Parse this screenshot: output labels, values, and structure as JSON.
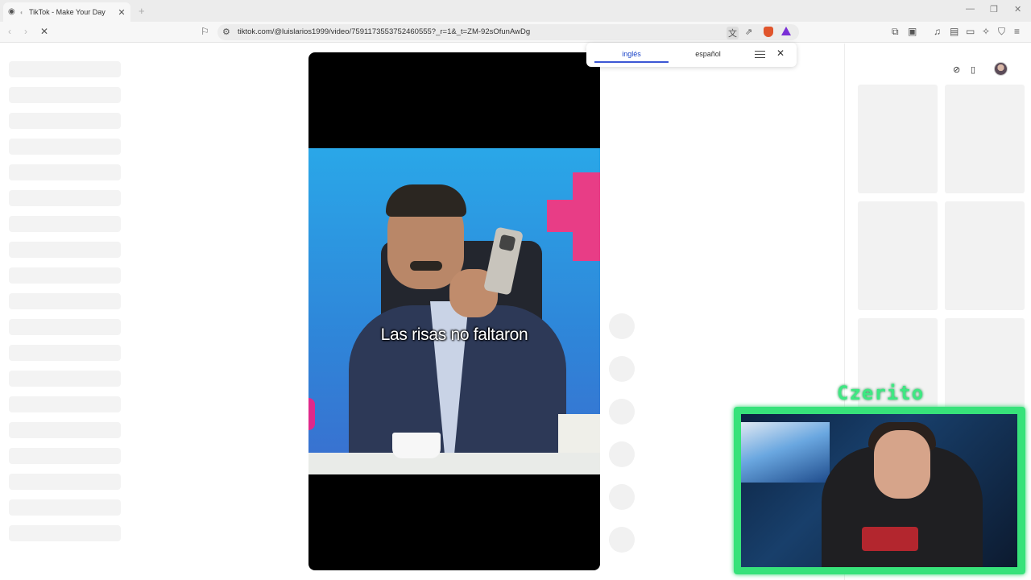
{
  "browser": {
    "tab_title": "TikTok - Make Your Day",
    "tab_close": "✕",
    "new_tab": "+",
    "url": "tiktok.com/@luislarios1999/video/7591173553752460555?_r=1&_t=ZM-92sOfunAwDg",
    "window_controls": {
      "minimize": "—",
      "restore": "❐",
      "close": "✕"
    }
  },
  "translate_popup": {
    "source_lang": "inglés",
    "target_lang": "español",
    "close": "✕"
  },
  "video": {
    "caption": "Las risas no faltaron"
  },
  "webcam": {
    "streamer_name": "Czerito"
  },
  "colors": {
    "accent_green": "#37e27a",
    "translate_accent": "#3b56d4"
  }
}
